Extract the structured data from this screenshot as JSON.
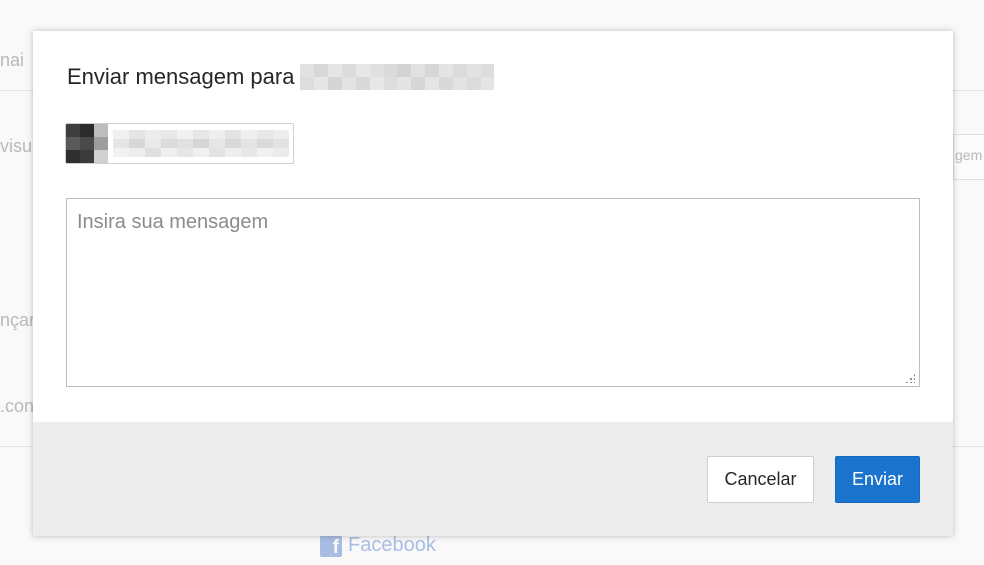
{
  "background": {
    "left_fragments": [
      "nai",
      "visu",
      "nçar",
      ".con"
    ],
    "right_fragment": "gem",
    "facebook_label": "Facebook"
  },
  "modal": {
    "title": "Enviar mensagem para",
    "message_placeholder": "Insira sua mensagem",
    "message_value": "",
    "cancel_label": "Cancelar",
    "send_label": "Enviar"
  },
  "colors": {
    "primary": "#1a73cc",
    "footer_bg": "#ededed",
    "facebook": "#a9bde3"
  },
  "icons": {
    "facebook": "facebook-icon",
    "resize": "resize-grip-icon"
  }
}
